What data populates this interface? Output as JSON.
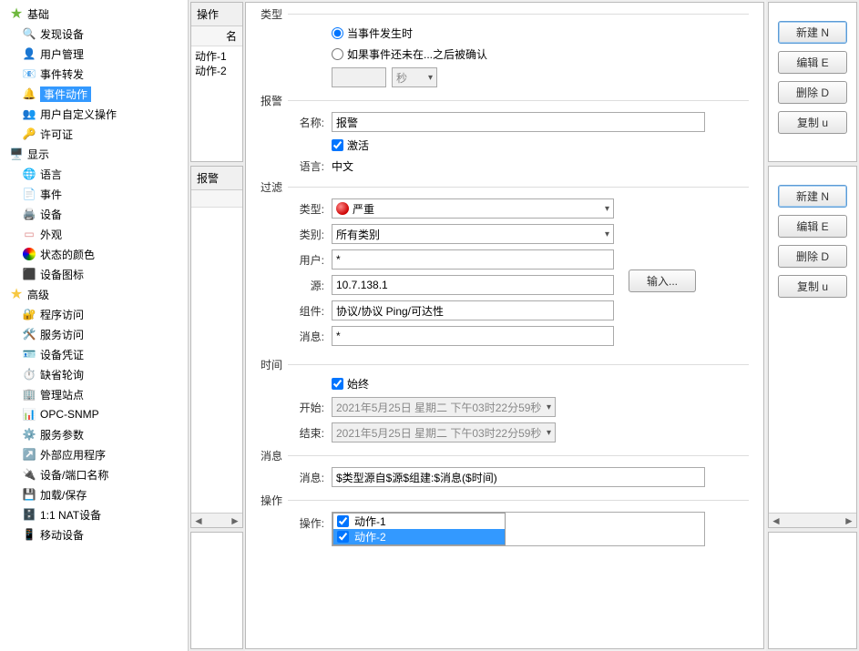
{
  "sidebar": {
    "groups": [
      {
        "label": "基础",
        "items": [
          "发现设备",
          "用户管理",
          "事件转发",
          "事件动作",
          "用户自定义操作",
          "许可证"
        ]
      },
      {
        "label": "显示",
        "items": [
          "语言",
          "事件",
          "设备",
          "外观",
          "状态的颜色",
          "设备图标"
        ]
      },
      {
        "label": "高级",
        "items": [
          "程序访问",
          "服务访问",
          "设备凭证",
          "缺省轮询",
          "管理站点",
          "OPC-SNMP",
          "服务参数",
          "外部应用程序",
          "设备/端口名称",
          "加载/保存",
          "1:1 NAT设备",
          "移动设备"
        ]
      }
    ],
    "selected": "事件动作"
  },
  "middle": {
    "operations": {
      "title": "操作",
      "col": "名",
      "items": [
        "动作-1",
        "动作-2"
      ]
    },
    "alarms": {
      "title": "报警",
      "col": "",
      "items": []
    }
  },
  "form": {
    "type": {
      "section": "类型",
      "radio1": "当事件发生时",
      "radio2": "如果事件还未在...之后被确认",
      "unit": "秒",
      "radio_selected": 1,
      "value": ""
    },
    "alarm": {
      "section": "报警",
      "name_label": "名称:",
      "name_value": "报警",
      "activate_label": "激活",
      "activate_checked": true,
      "lang_label": "语言:",
      "lang_value": "中文"
    },
    "filter": {
      "section": "过滤",
      "type_label": "类型:",
      "type_value": "严重",
      "cat_label": "类别:",
      "cat_value": "所有类别",
      "user_label": "用户:",
      "user_value": "*",
      "src_label": "源:",
      "src_value": "10.7.138.1",
      "comp_label": "组件:",
      "comp_value": "协议/协议 Ping/可达性",
      "msg_label": "消息:",
      "msg_value": "*",
      "input_btn": "输入..."
    },
    "time": {
      "section": "时间",
      "always_label": "始终",
      "always_checked": true,
      "start_label": "开始:",
      "start_value": "2021年5月25日 星期二 下午03时22分59秒",
      "end_label": "结束:",
      "end_value": "2021年5月25日 星期二 下午03时22分59秒"
    },
    "message": {
      "section": "消息",
      "label": "消息:",
      "value": "$类型源自$源$组建:$消息($时间)"
    },
    "action": {
      "section": "操作",
      "label": "操作:",
      "items": [
        {
          "label": "动作-1",
          "checked": true,
          "selected": false
        },
        {
          "label": "动作-2",
          "checked": true,
          "selected": true
        }
      ]
    }
  },
  "right": {
    "new": "新建 N",
    "edit": "编辑 E",
    "delete": "删除 D",
    "copy": "复制 u"
  }
}
